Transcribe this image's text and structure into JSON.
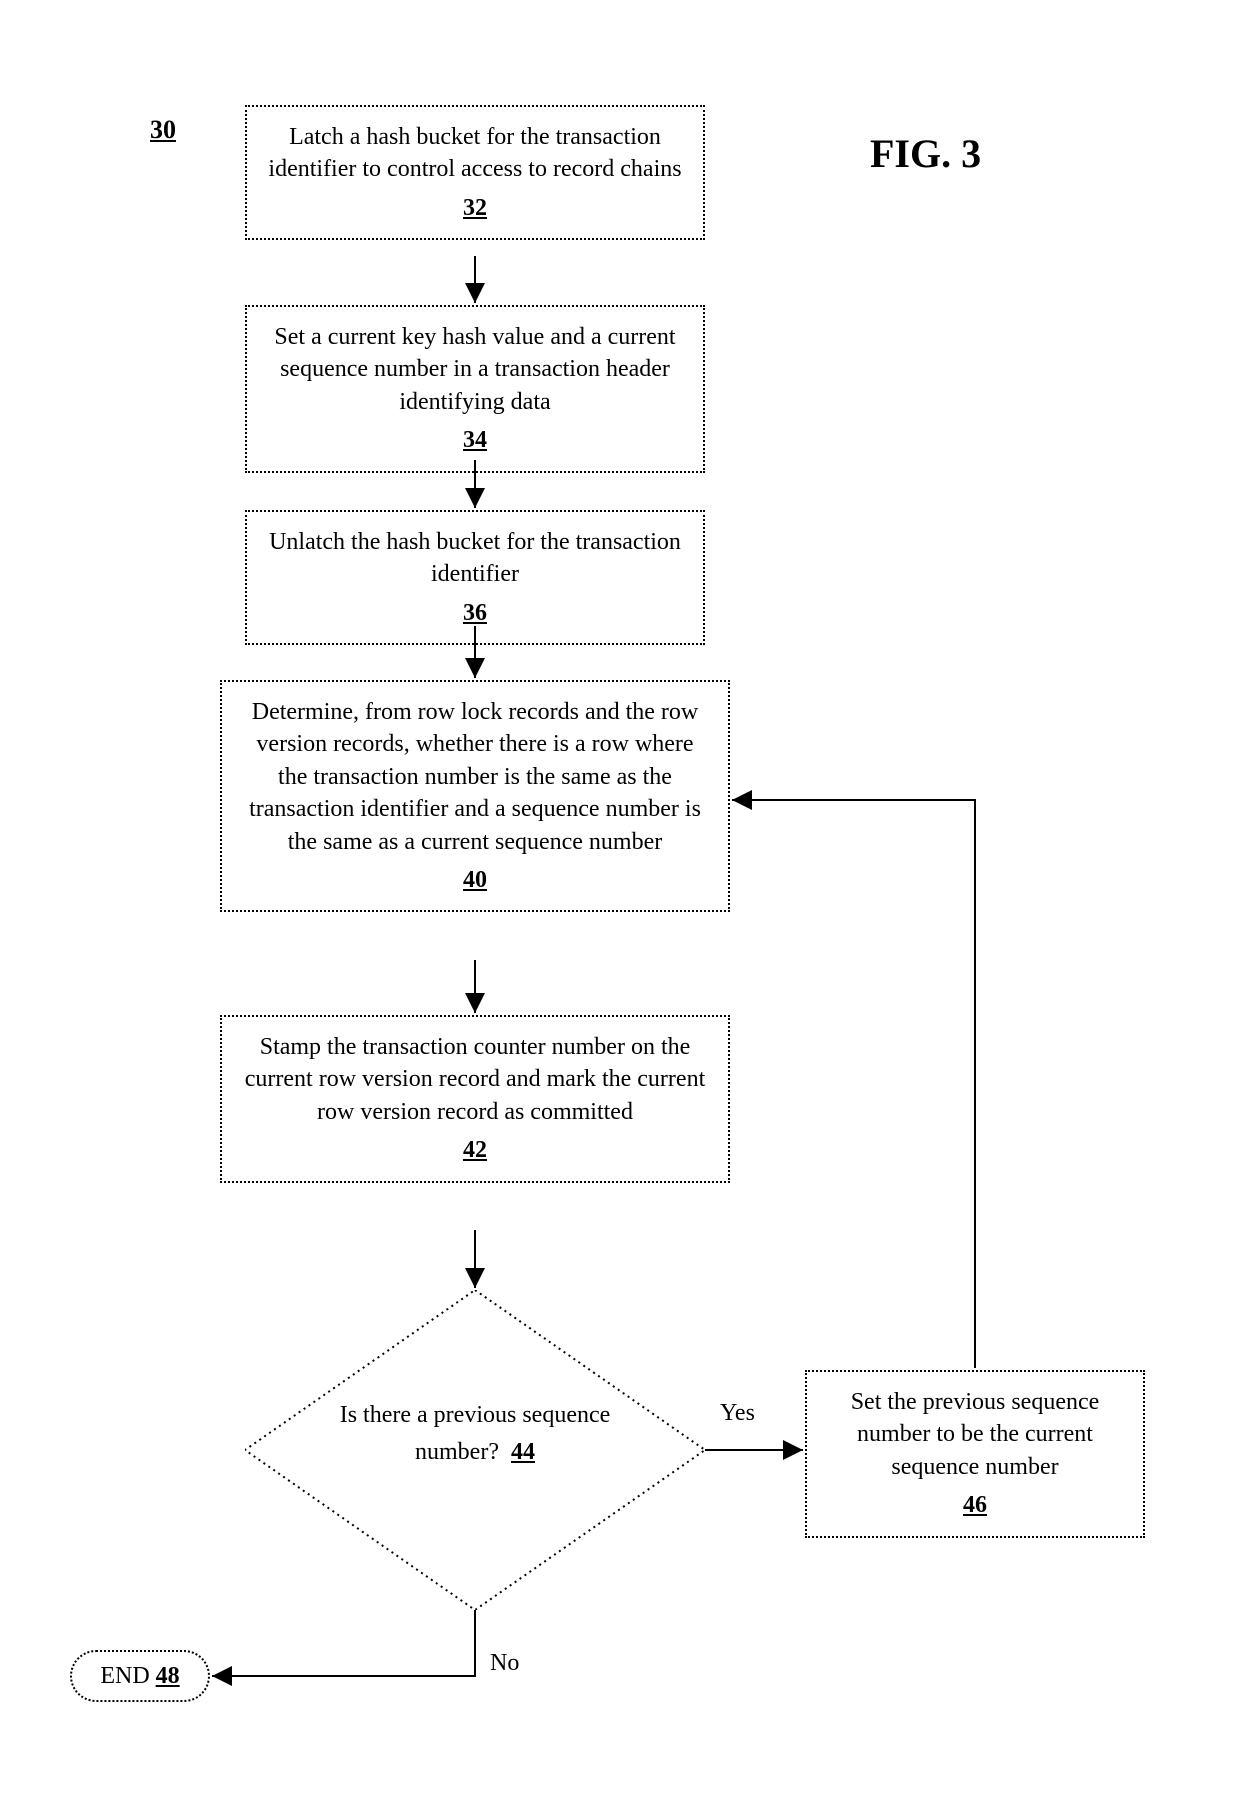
{
  "figure": "FIG. 3",
  "diagram_ref": "30",
  "boxes": {
    "b32": {
      "text": "Latch a hash bucket for the transaction identifier to control access to record chains",
      "ref": "32"
    },
    "b34": {
      "text": "Set a current key hash value and a current sequence number in a transaction header identifying data",
      "ref": "34"
    },
    "b36": {
      "text": "Unlatch the hash bucket for the transaction identifier",
      "ref": "36"
    },
    "b40": {
      "text": "Determine, from row lock records and the row version records, whether there is a row where the transaction number is the same as the transaction identifier and a sequence number is the same as a current sequence number",
      "ref": "40"
    },
    "b42": {
      "text": "Stamp the transaction counter number on the current row version record and mark the current row version record as committed",
      "ref": "42"
    },
    "b46": {
      "text": "Set the previous sequence number to be the current sequence number",
      "ref": "46"
    }
  },
  "decision": {
    "text": "Is there a previous sequence number?",
    "ref": "44"
  },
  "end": {
    "text": "END",
    "ref": "48"
  },
  "edge_labels": {
    "yes": "Yes",
    "no": "No"
  }
}
